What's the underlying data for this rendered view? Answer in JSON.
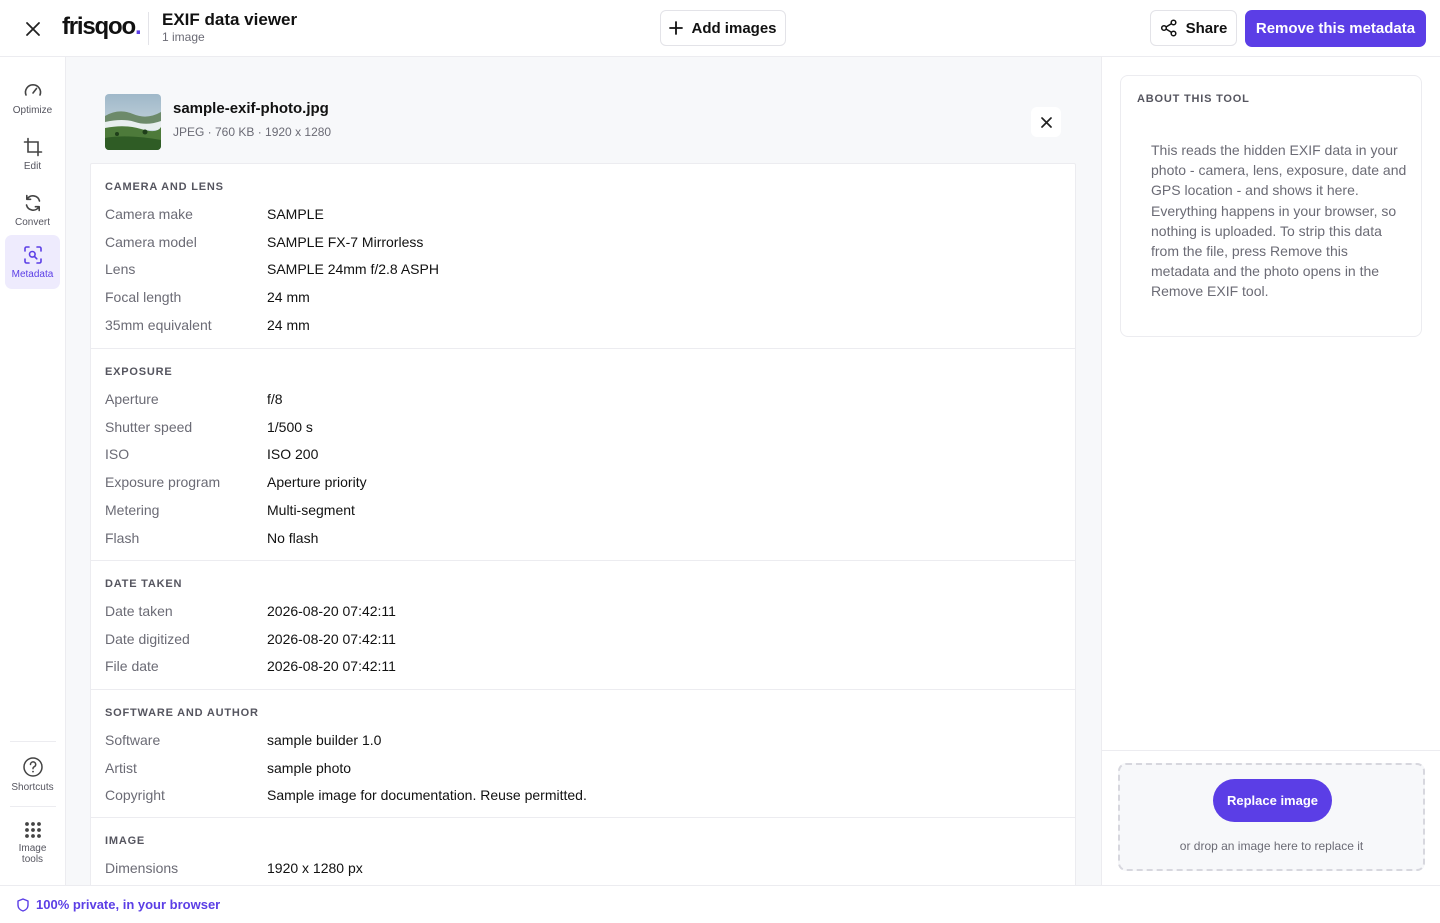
{
  "header": {
    "logo_text": "frisqoo",
    "logo_dot": ".",
    "title": "EXIF data viewer",
    "subtitle": "1 image",
    "add_images_label": "Add images",
    "share_label": "Share",
    "remove_metadata_label": "Remove this metadata"
  },
  "rail": {
    "items": [
      {
        "label": "Optimize",
        "icon": "gauge-icon"
      },
      {
        "label": "Edit",
        "icon": "crop-icon"
      },
      {
        "label": "Convert",
        "icon": "refresh-icon"
      },
      {
        "label": "Metadata",
        "icon": "scan-search-icon",
        "active": true
      }
    ],
    "bottom": [
      {
        "label": "Shortcuts",
        "icon": "help-circle-icon"
      },
      {
        "label": "Image tools",
        "icon": "grid-icon"
      }
    ],
    "image_tools_line1": "Image",
    "image_tools_line2": "tools"
  },
  "file": {
    "name": "sample-exif-photo.jpg",
    "meta": "JPEG · 760 KB · 1920 x 1280"
  },
  "sections": [
    {
      "title": "CAMERA AND LENS",
      "rows": [
        {
          "k": "Camera make",
          "v": "SAMPLE"
        },
        {
          "k": "Camera model",
          "v": "SAMPLE FX-7 Mirrorless"
        },
        {
          "k": "Lens",
          "v": "SAMPLE 24mm f/2.8 ASPH"
        },
        {
          "k": "Focal length",
          "v": "24 mm"
        },
        {
          "k": "35mm equivalent",
          "v": "24 mm"
        }
      ]
    },
    {
      "title": "EXPOSURE",
      "rows": [
        {
          "k": "Aperture",
          "v": "f/8"
        },
        {
          "k": "Shutter speed",
          "v": "1/500 s"
        },
        {
          "k": "ISO",
          "v": "ISO 200"
        },
        {
          "k": "Exposure program",
          "v": "Aperture priority"
        },
        {
          "k": "Metering",
          "v": "Multi-segment"
        },
        {
          "k": "Flash",
          "v": "No flash"
        }
      ]
    },
    {
      "title": "DATE TAKEN",
      "rows": [
        {
          "k": "Date taken",
          "v": "2026-08-20 07:42:11"
        },
        {
          "k": "Date digitized",
          "v": "2026-08-20 07:42:11"
        },
        {
          "k": "File date",
          "v": "2026-08-20 07:42:11"
        }
      ]
    },
    {
      "title": "SOFTWARE AND AUTHOR",
      "rows": [
        {
          "k": "Software",
          "v": "sample builder 1.0"
        },
        {
          "k": "Artist",
          "v": "sample photo"
        },
        {
          "k": "Copyright",
          "v": "Sample image for documentation. Reuse permitted."
        }
      ]
    },
    {
      "title": "IMAGE",
      "rows": [
        {
          "k": "Dimensions",
          "v": "1920 x 1280 px"
        }
      ]
    }
  ],
  "about": {
    "title": "ABOUT THIS TOOL",
    "text": "This reads the hidden EXIF data in your photo - camera, lens, exposure, date and GPS location - and shows it here. Everything happens in your browser, so nothing is uploaded. To strip this data from the file, press Remove this metadata and the photo opens in the Remove EXIF tool."
  },
  "dropzone": {
    "button_label": "Replace image",
    "hint": "or drop an image here to replace it"
  },
  "footer": {
    "privacy_text": "100% private, in your browser"
  },
  "colors": {
    "accent": "#5b3ee6",
    "accent_soft": "#eeebfd",
    "muted_text": "#6b6b75",
    "border": "#ececf0",
    "main_bg": "#f7f8fa"
  }
}
